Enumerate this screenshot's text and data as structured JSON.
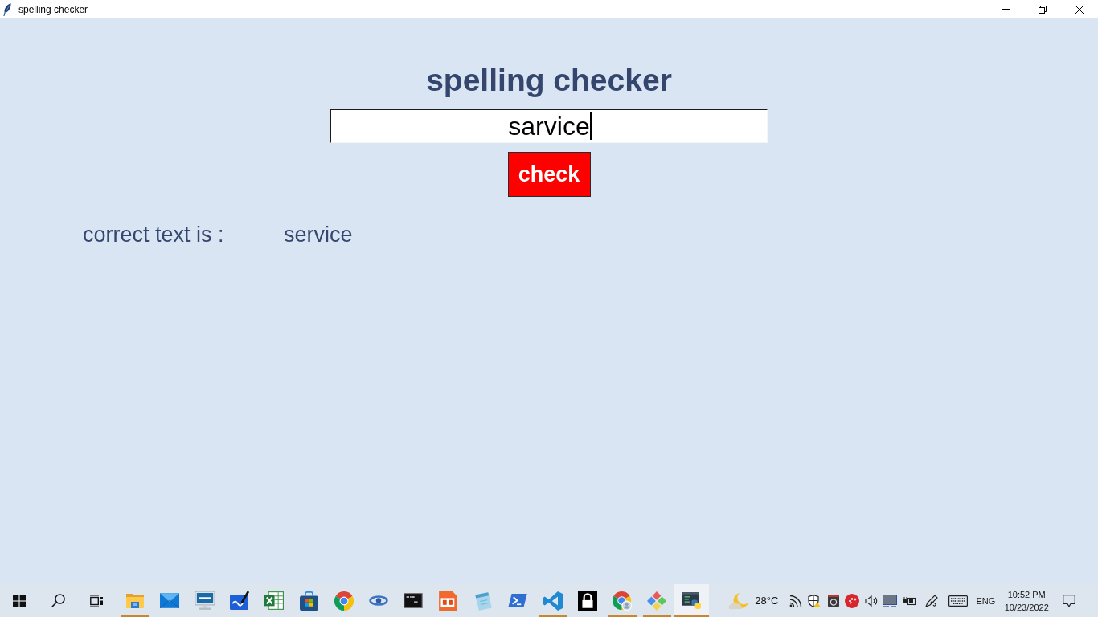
{
  "window": {
    "title": "spelling checker"
  },
  "heading": "spelling checker",
  "word_field": {
    "value": "sarvice",
    "focused": true
  },
  "check_button": "check",
  "result": {
    "label": "correct text is :",
    "value": "service"
  },
  "taskbar": {
    "apps": [
      {
        "kind": "folder",
        "running": true,
        "selected": false
      },
      {
        "kind": "mail",
        "running": false,
        "selected": false
      },
      {
        "kind": "monitor",
        "running": false,
        "selected": false
      },
      {
        "kind": "whiteboard",
        "running": false,
        "selected": false
      },
      {
        "kind": "spreadsheet",
        "running": false,
        "selected": false
      },
      {
        "kind": "store",
        "running": false,
        "selected": false
      },
      {
        "kind": "browser",
        "running": false,
        "selected": false
      },
      {
        "kind": "ring",
        "running": false,
        "selected": false
      },
      {
        "kind": "terminal",
        "running": false,
        "selected": false
      },
      {
        "kind": "document",
        "running": false,
        "selected": false
      },
      {
        "kind": "notepad",
        "running": false,
        "selected": false
      },
      {
        "kind": "prompt",
        "running": false,
        "selected": false
      },
      {
        "kind": "code-editor",
        "running": true,
        "selected": false
      },
      {
        "kind": "padlock",
        "running": false,
        "selected": false
      },
      {
        "kind": "browser-profile",
        "running": true,
        "selected": false
      },
      {
        "kind": "diamond-tiles",
        "running": true,
        "selected": false
      },
      {
        "kind": "code-window",
        "running": true,
        "selected": true
      }
    ],
    "weather": "28°C",
    "language": "ENG",
    "time": "10:52 PM",
    "date": "10/23/2022"
  }
}
